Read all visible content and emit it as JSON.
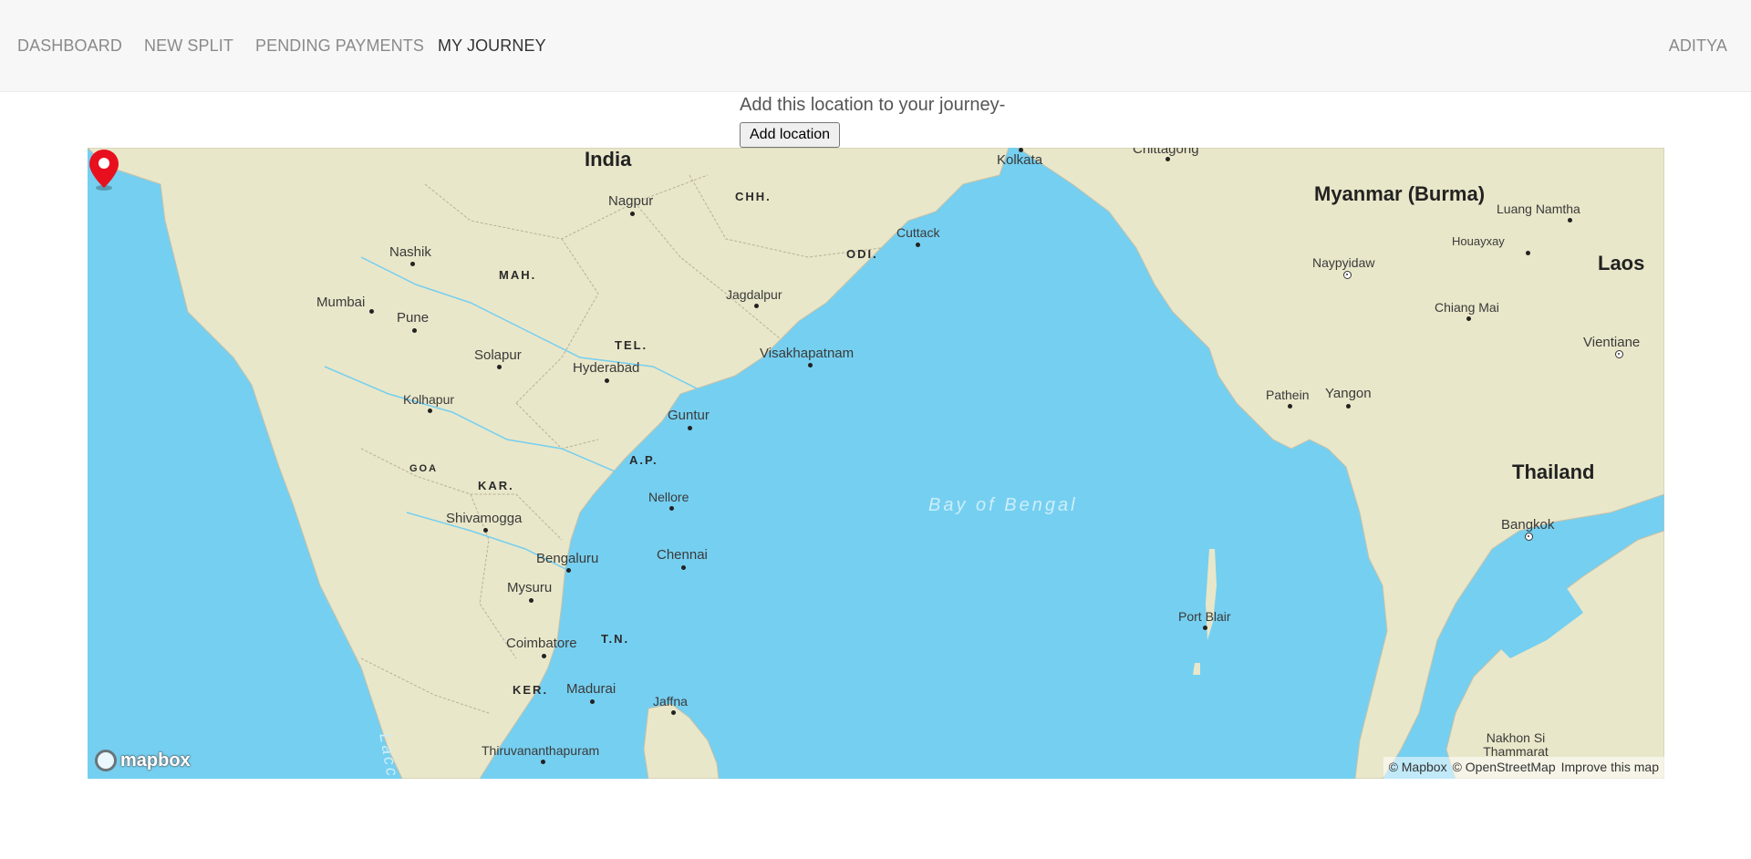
{
  "nav": {
    "dashboard": "DASHBOARD",
    "new_split": "NEW SPLIT",
    "pending_payments": "PENDING PAYMENTS",
    "my_journey": "MY JOURNEY",
    "user": "ADITYA"
  },
  "journey": {
    "prompt": "Add this location to your journey-",
    "add_button": "Add location"
  },
  "map": {
    "countries": [
      "India",
      "Myanmar (Burma)",
      "Laos",
      "Thailand"
    ],
    "water": [
      "Bay of Bengal",
      "Laccad"
    ],
    "states": [
      "CHH.",
      "MAH.",
      "ODI.",
      "TEL.",
      "A.P.",
      "GOA",
      "KAR.",
      "T.N.",
      "KER."
    ],
    "cities": [
      "Kolkata",
      "Chittagong",
      "Nagpur",
      "Cuttack",
      "Nashik",
      "Mumbai",
      "Pune",
      "Jagdalpur",
      "Solapur",
      "Hyderabad",
      "Visakhapatnam",
      "Kolhapur",
      "Guntur",
      "Nellore",
      "Shivamogga",
      "Bengaluru",
      "Chennai",
      "Mysuru",
      "Coimbatore",
      "Madurai",
      "Jaffna",
      "Thiruvananthapuram",
      "Port Blair",
      "Pathein",
      "Yangon",
      "Naypyidaw",
      "Luang Namtha",
      "Houayxay",
      "Chiang Mai",
      "Vientiane",
      "Bangkok",
      "Nakhon Si Thammarat"
    ],
    "logo": "mapbox",
    "attribution": [
      "© Mapbox",
      "© OpenStreetMap",
      "Improve this map"
    ],
    "marker_color": "#e8101e",
    "land_color": "#e9e7c9",
    "water_color": "#75cff0"
  }
}
